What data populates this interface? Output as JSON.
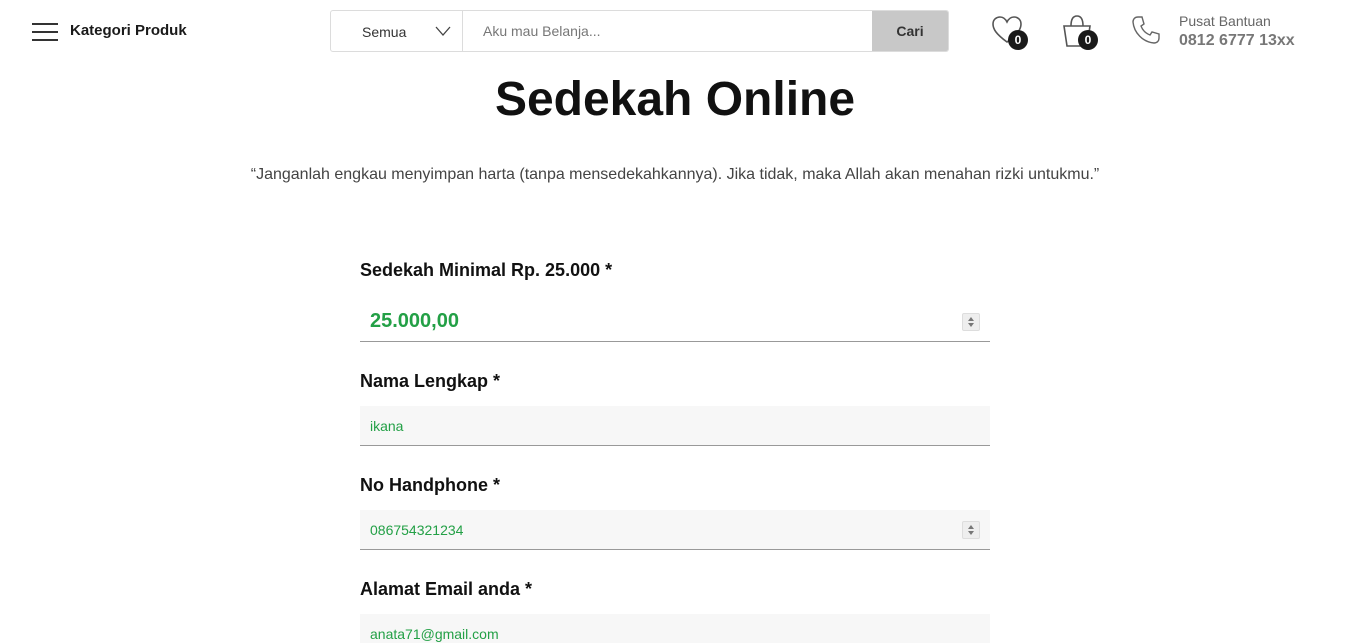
{
  "header": {
    "category_label": "Kategori Produk",
    "search": {
      "category_selected": "Semua",
      "placeholder": "Aku mau Belanja...",
      "button_label": "Cari"
    },
    "wishlist_count": "0",
    "cart_count": "0",
    "help_label": "Pusat Bantuan",
    "help_number": "0812 6777 13xx"
  },
  "main": {
    "title": "Sedekah Online",
    "quote": "“Janganlah engkau menyimpan harta (tanpa mensedekahkannya). Jika tidak, maka Allah akan menahan rizki untukmu.”"
  },
  "form": {
    "amount": {
      "label": "Sedekah Minimal Rp. 25.000 *",
      "value": "25.000,00"
    },
    "name": {
      "label": "Nama Lengkap *",
      "value": "ikana"
    },
    "phone": {
      "label": "No Handphone *",
      "value": "086754321234"
    },
    "email": {
      "label": "Alamat Email anda *",
      "value": "anata71@gmail.com"
    }
  },
  "colors": {
    "accent_green": "#23a046",
    "search_button": "#c8c8c8"
  }
}
